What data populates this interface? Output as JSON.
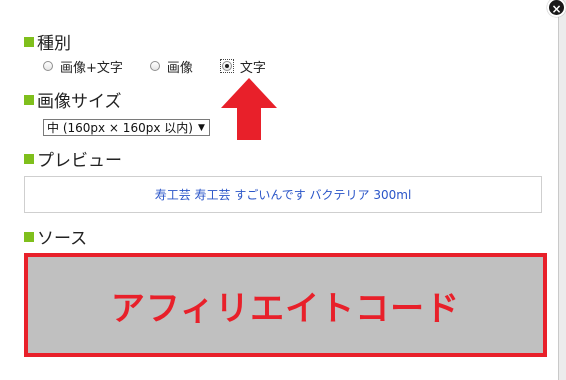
{
  "dialog": {
    "close_icon": "×"
  },
  "sections": {
    "type_title": "種別",
    "image_size_title": "画像サイズ",
    "preview_title": "プレビュー",
    "source_title": "ソース"
  },
  "type_options": [
    {
      "label": "画像+文字",
      "checked": false
    },
    {
      "label": "画像",
      "checked": false
    },
    {
      "label": "文字",
      "checked": true
    }
  ],
  "image_size": {
    "selected": "中 (160px × 160px 以内)",
    "arrow": "▼"
  },
  "preview": {
    "link_text": "寿工芸 寿工芸 すごいんです バクテリア 300ml"
  },
  "source": {
    "text": "アフィリエイトコード"
  },
  "colors": {
    "accent_square": "#7fbf1c",
    "annotation_red": "#e8202a",
    "source_bg": "#c0c0c0",
    "link": "#2a55c8"
  },
  "icons": {
    "annotation_arrow": "red-up-arrow-icon",
    "close": "close-icon"
  }
}
